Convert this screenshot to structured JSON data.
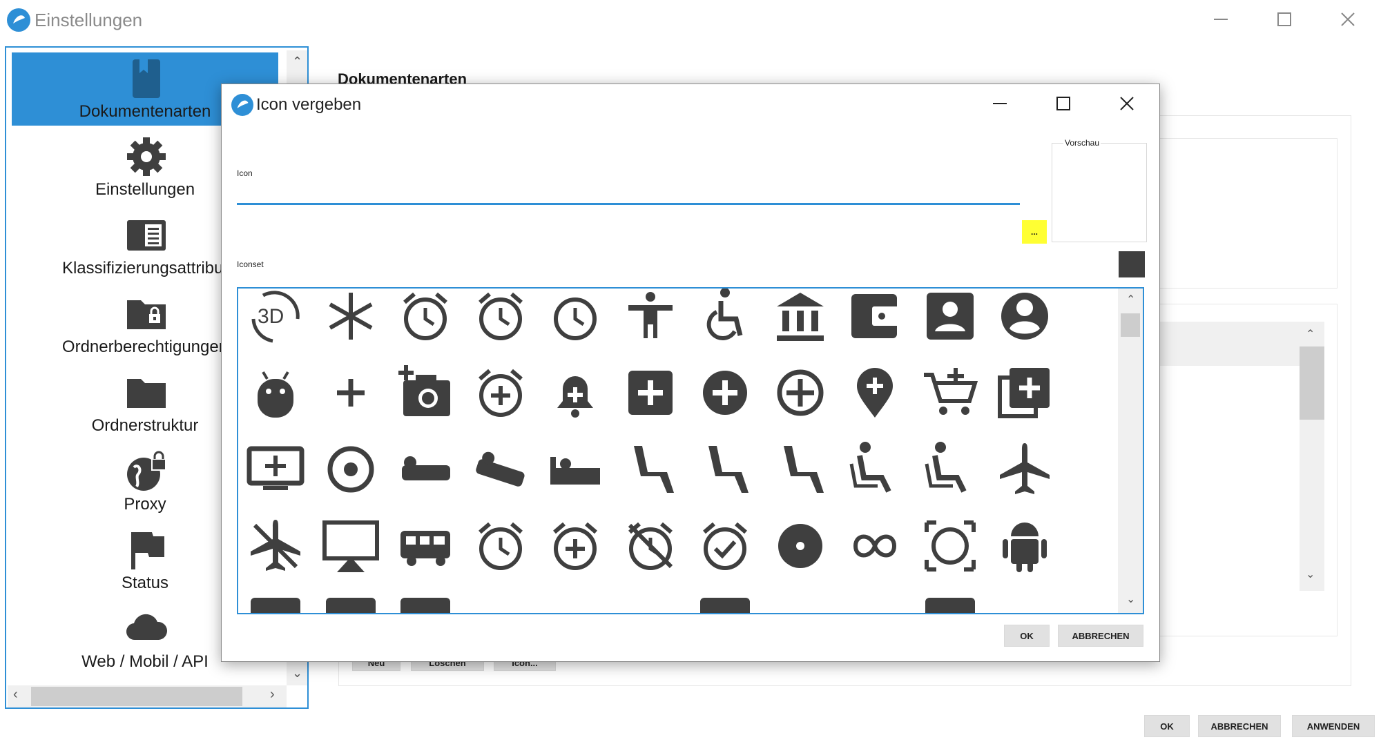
{
  "main_window": {
    "title": "Einstellungen",
    "section_heading": "Dokumentenarten",
    "buttons": {
      "ok": "OK",
      "cancel": "ABBRECHEN",
      "apply": "ANWENDEN"
    },
    "hidden_buttons": [
      "Neu",
      "Löschen",
      "Icon..."
    ]
  },
  "sidebar": {
    "items": [
      {
        "label": "Dokumentenarten",
        "icon": "bookmark-book-icon",
        "active": true
      },
      {
        "label": "Einstellungen",
        "icon": "gear-icon",
        "active": false
      },
      {
        "label": "Klassifizierungsattribut",
        "icon": "list-card-icon",
        "active": false
      },
      {
        "label": "Ordnerberechtigungen",
        "icon": "locked-folder-icon",
        "active": false
      },
      {
        "label": "Ordnerstruktur",
        "icon": "folder-icon",
        "active": false
      },
      {
        "label": "Proxy",
        "icon": "globe-lock-icon",
        "active": false
      },
      {
        "label": "Status",
        "icon": "flag-icon",
        "active": false
      },
      {
        "label": "Web / Mobil / API",
        "icon": "cloud-icon",
        "active": false
      }
    ]
  },
  "dialog": {
    "title": "Icon vergeben",
    "icon_label": "Icon",
    "icon_value": "",
    "browse_button": "...",
    "preview_label": "Vorschau",
    "iconset_label": "Iconset",
    "ok": "OK",
    "cancel": "ABBRECHEN",
    "icons": [
      [
        "3d-rotation-icon",
        "ac-unit-icon",
        "access-alarm-icon",
        "access-alarms-icon",
        "access-time-icon",
        "accessibility-icon",
        "accessible-icon",
        "account-balance-icon",
        "account-balance-wallet-icon",
        "account-box-icon",
        "account-circle-icon"
      ],
      [
        "adb-icon",
        "add-icon",
        "add-a-photo-icon",
        "add-alarm-icon",
        "add-alert-icon",
        "add-box-icon",
        "add-circle-icon",
        "add-circle-outline-icon",
        "add-location-icon",
        "add-shopping-cart-icon",
        "add-to-photos-icon"
      ],
      [
        "add-to-queue-icon",
        "adjust-icon",
        "airline-seat-flat-icon",
        "airline-seat-flat-angled-icon",
        "airline-seat-individual-suite-icon",
        "airline-seat-legroom-extra-icon",
        "airline-seat-legroom-normal-icon",
        "airline-seat-legroom-reduced-icon",
        "airline-seat-recline-extra-icon",
        "airline-seat-recline-normal-icon",
        "airplanemode-active-icon"
      ],
      [
        "airplanemode-inactive-icon",
        "airplay-icon",
        "airport-shuttle-icon",
        "alarm-icon",
        "alarm-add-icon",
        "alarm-off-icon",
        "alarm-on-icon",
        "album-icon",
        "all-inclusive-icon",
        "all-out-icon",
        "android-icon"
      ]
    ]
  }
}
